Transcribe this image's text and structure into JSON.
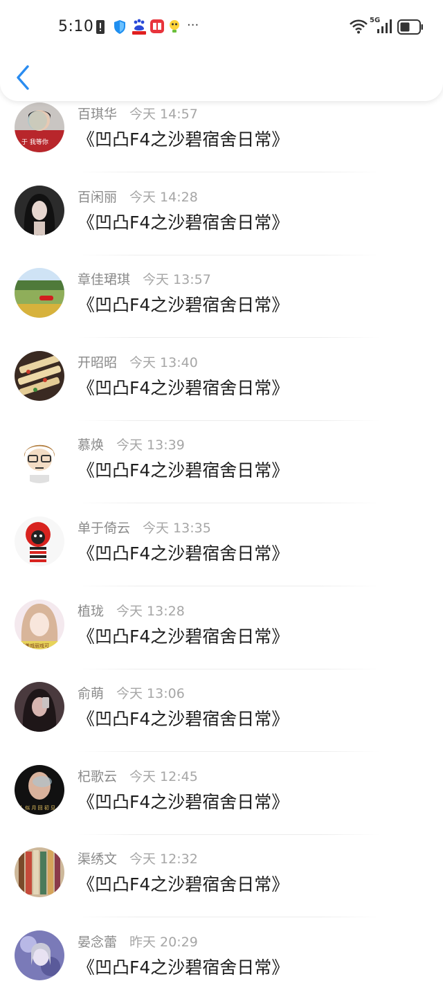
{
  "status_bar": {
    "time": "5:10",
    "icons": [
      "sim-warning-icon",
      "shield-icon",
      "baidu-icon",
      "book-app-icon",
      "lightbulb-app-icon",
      "more-dots-icon"
    ],
    "right_icons": [
      "wifi-icon",
      "5g-signal-icon",
      "battery-icon"
    ],
    "more": "···",
    "net": "5G"
  },
  "header": {
    "back_icon": "chevron-left-icon"
  },
  "items": [
    {
      "name": "百琪华",
      "time": "今天 14:57",
      "title": "《凹凸F4之沙碧宿舍日常》"
    },
    {
      "name": "百闲丽",
      "time": "今天 14:28",
      "title": "《凹凸F4之沙碧宿舍日常》"
    },
    {
      "name": "章佳珺琪",
      "time": "今天 13:57",
      "title": "《凹凸F4之沙碧宿舍日常》"
    },
    {
      "name": "开昭昭",
      "time": "今天 13:40",
      "title": "《凹凸F4之沙碧宿舍日常》"
    },
    {
      "name": "慕焕",
      "time": "今天 13:39",
      "title": "《凹凸F4之沙碧宿舍日常》"
    },
    {
      "name": "单于倚云",
      "time": "今天 13:35",
      "title": "《凹凸F4之沙碧宿舍日常》"
    },
    {
      "name": "植珑",
      "time": "今天 13:28",
      "title": "《凹凸F4之沙碧宿舍日常》"
    },
    {
      "name": "俞萌",
      "time": "今天 13:06",
      "title": "《凹凸F4之沙碧宿舍日常》"
    },
    {
      "name": "杞歌云",
      "time": "今天 12:45",
      "title": "《凹凸F4之沙碧宿舍日常》"
    },
    {
      "name": "渠绣文",
      "time": "今天 12:32",
      "title": "《凹凸F4之沙碧宿舍日常》"
    },
    {
      "name": "晏念蕾",
      "time": "昨天 20:29",
      "title": "《凹凸F4之沙碧宿舍日常》"
    }
  ],
  "avatar_texts": {
    "a0": "于 我等你",
    "a6": "戏美戏丽戏可",
    "a8": "人 似 月 回 初 见"
  },
  "colors": {
    "accent": "#2a8cf0",
    "title_text": "#1d1d1d",
    "meta_text": "#8a8a8a"
  }
}
